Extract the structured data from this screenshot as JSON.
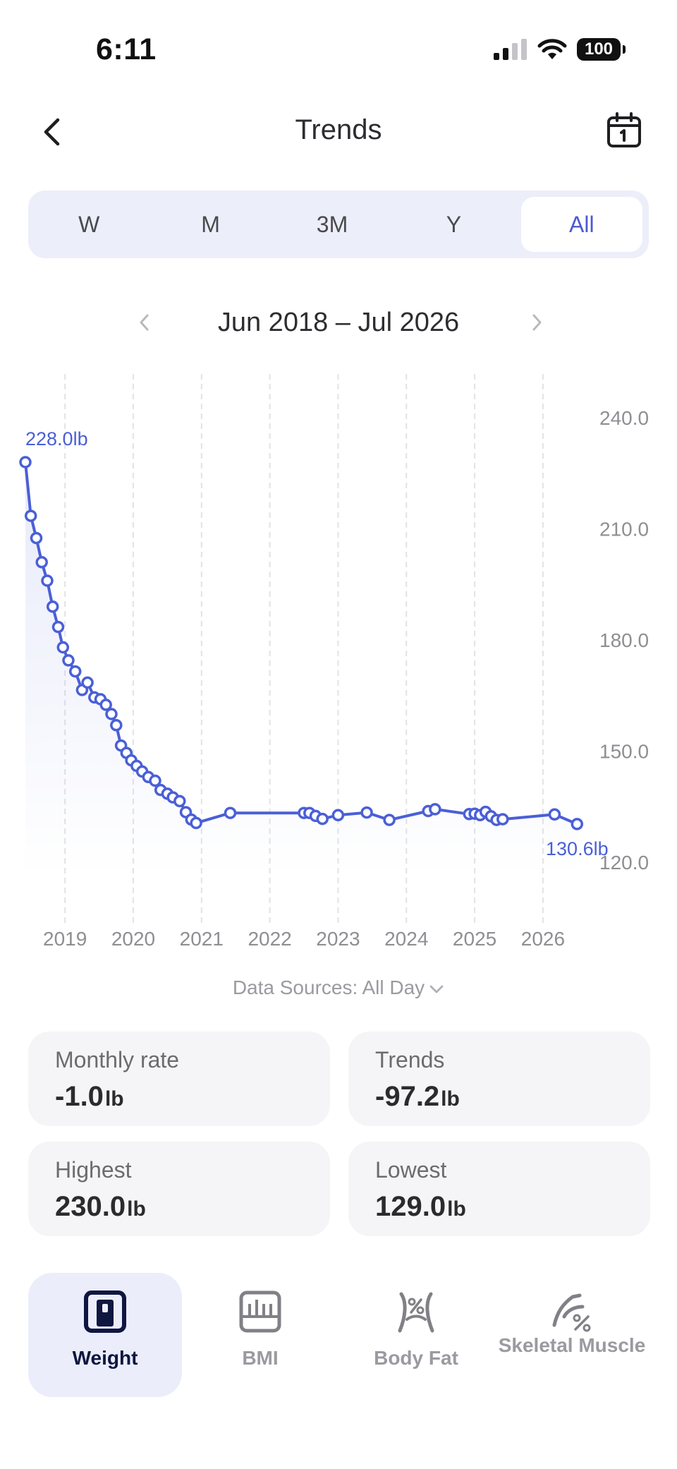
{
  "status_bar": {
    "time": "6:11",
    "battery": "100"
  },
  "nav": {
    "title": "Trends",
    "back_icon": "chevron-left-icon",
    "calendar_icon": "calendar-icon"
  },
  "segments": [
    {
      "label": "W",
      "selected": false
    },
    {
      "label": "M",
      "selected": false
    },
    {
      "label": "3M",
      "selected": false
    },
    {
      "label": "Y",
      "selected": false
    },
    {
      "label": "All",
      "selected": true
    }
  ],
  "date_range": {
    "label": "Jun 2018 – Jul 2026"
  },
  "chart_data": {
    "type": "line",
    "x_axis_ticks": [
      "2019",
      "2020",
      "2021",
      "2022",
      "2023",
      "2024",
      "2025",
      "2026"
    ],
    "y_axis_ticks": [
      "240.0",
      "210.0",
      "180.0",
      "150.0",
      "120.0"
    ],
    "ylim": [
      120,
      240
    ],
    "xlim": [
      2018.42,
      2026.6
    ],
    "grid": "vertical dashed",
    "color": "#4a5fd6",
    "annotations": {
      "max_label": "228.0lb",
      "min_label": "130.6lb"
    },
    "points": [
      [
        2018.42,
        228.0
      ],
      [
        2018.5,
        213.5
      ],
      [
        2018.58,
        207.5
      ],
      [
        2018.66,
        201.0
      ],
      [
        2018.74,
        196.0
      ],
      [
        2018.82,
        189.0
      ],
      [
        2018.9,
        183.5
      ],
      [
        2018.97,
        178.0
      ],
      [
        2019.05,
        174.5
      ],
      [
        2019.15,
        171.5
      ],
      [
        2019.25,
        166.5
      ],
      [
        2019.33,
        168.5
      ],
      [
        2019.43,
        164.5
      ],
      [
        2019.52,
        164.0
      ],
      [
        2019.6,
        162.5
      ],
      [
        2019.68,
        160.0
      ],
      [
        2019.75,
        157.0
      ],
      [
        2019.82,
        151.5
      ],
      [
        2019.9,
        149.5
      ],
      [
        2019.97,
        147.5
      ],
      [
        2020.05,
        146.0
      ],
      [
        2020.13,
        144.5
      ],
      [
        2020.22,
        143.0
      ],
      [
        2020.32,
        142.0
      ],
      [
        2020.4,
        139.5
      ],
      [
        2020.5,
        138.5
      ],
      [
        2020.58,
        137.5
      ],
      [
        2020.68,
        136.5
      ],
      [
        2020.77,
        133.5
      ],
      [
        2020.85,
        131.5
      ],
      [
        2020.92,
        130.6
      ],
      [
        2021.42,
        133.3
      ],
      [
        2022.5,
        133.3
      ],
      [
        2022.58,
        133.3
      ],
      [
        2022.67,
        132.5
      ],
      [
        2022.77,
        131.7
      ],
      [
        2023.0,
        132.7
      ],
      [
        2023.42,
        133.4
      ],
      [
        2023.75,
        131.4
      ],
      [
        2024.32,
        133.8
      ],
      [
        2024.42,
        134.3
      ],
      [
        2024.92,
        133.0
      ],
      [
        2025.0,
        133.1
      ],
      [
        2025.08,
        132.7
      ],
      [
        2025.16,
        133.6
      ],
      [
        2025.24,
        132.4
      ],
      [
        2025.32,
        131.4
      ],
      [
        2025.41,
        131.6
      ],
      [
        2026.17,
        132.9
      ],
      [
        2026.5,
        130.3
      ]
    ]
  },
  "data_sources": {
    "label": "Data Sources: All Day"
  },
  "stats": [
    {
      "label": "Monthly rate",
      "value": "-1.0",
      "unit": "lb"
    },
    {
      "label": "Trends",
      "value": "-97.2",
      "unit": "lb"
    },
    {
      "label": "Highest",
      "value": "230.0",
      "unit": "lb"
    },
    {
      "label": "Lowest",
      "value": "129.0",
      "unit": "lb"
    }
  ],
  "bottom_tabs": [
    {
      "label": "Weight",
      "icon": "scale-icon",
      "selected": true
    },
    {
      "label": "BMI",
      "icon": "bmi-icon",
      "selected": false
    },
    {
      "label": "Body Fat",
      "icon": "body-fat-icon",
      "selected": false
    },
    {
      "label": "Skeletal Muscle",
      "icon": "skeletal-muscle-icon",
      "selected": false
    }
  ]
}
